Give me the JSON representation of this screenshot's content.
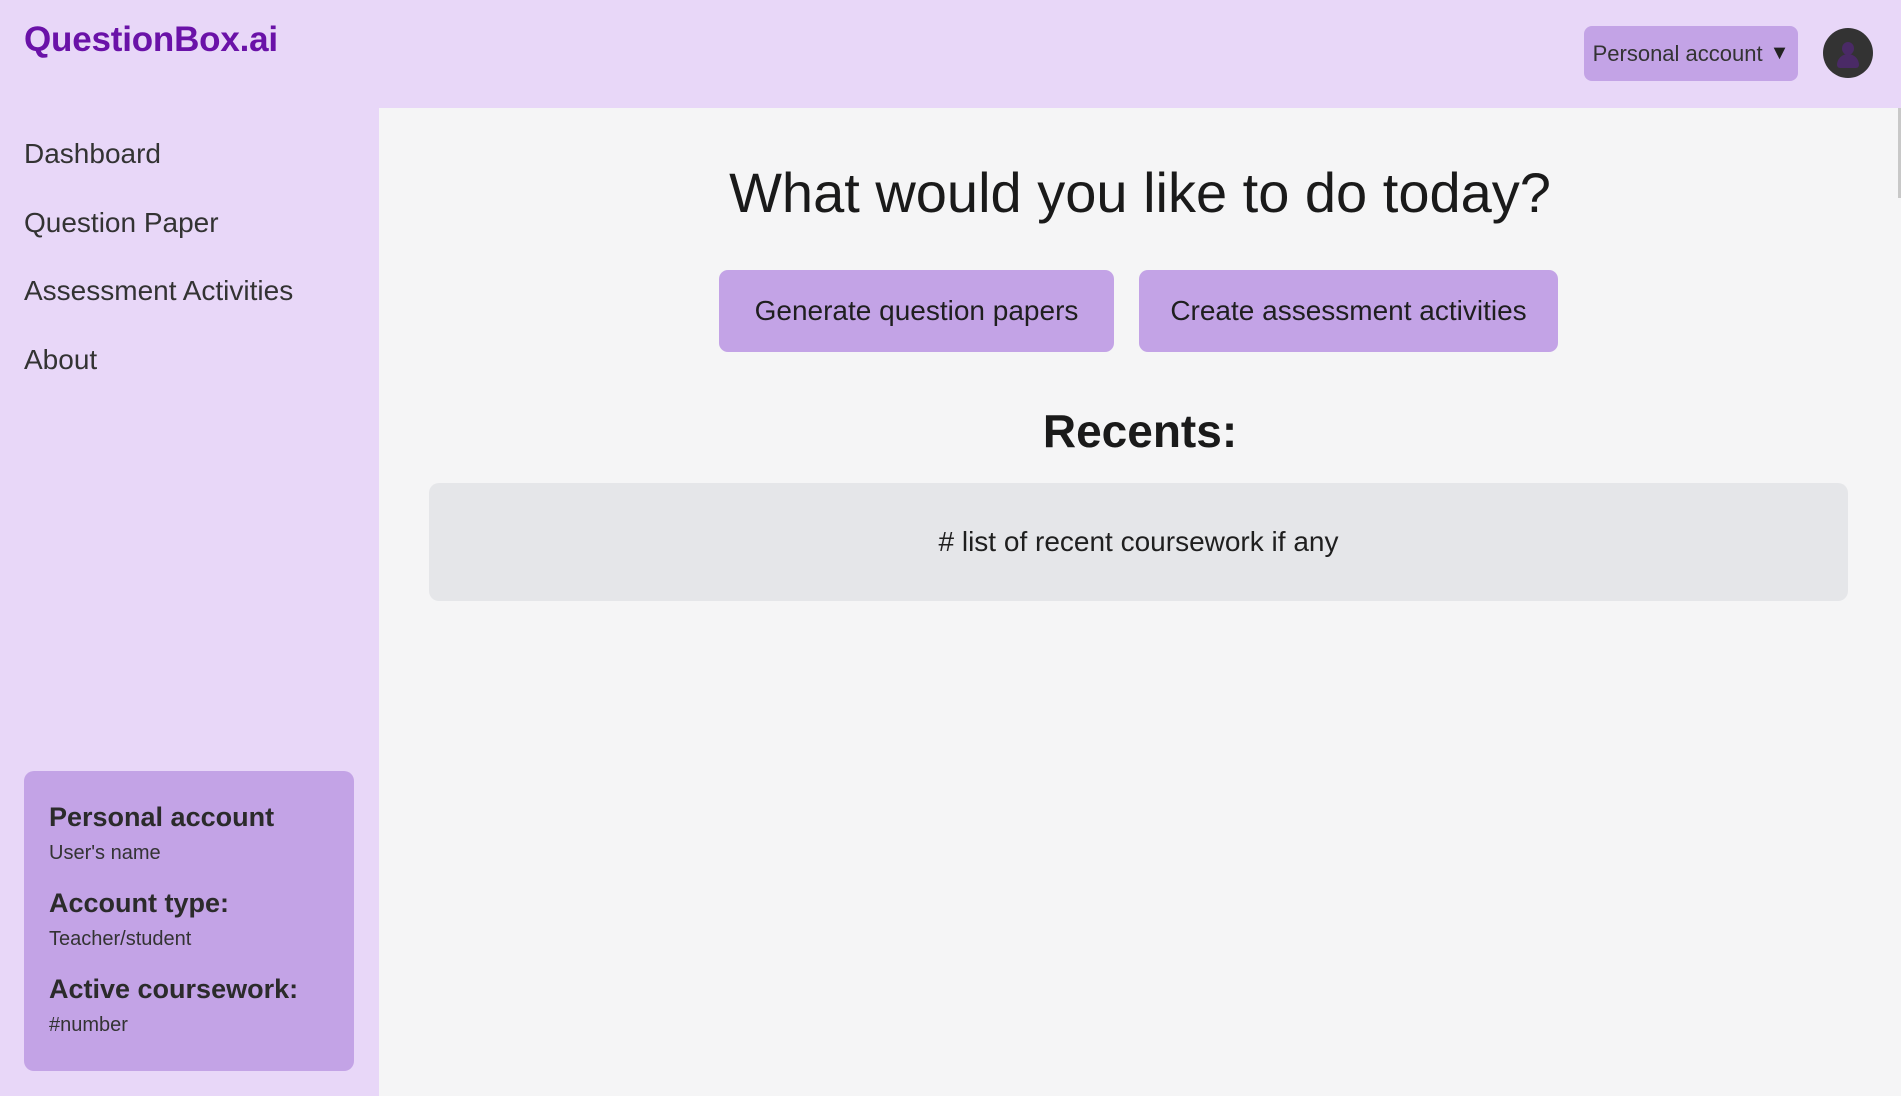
{
  "header": {
    "logo": "QuestionBox.ai",
    "account_dropdown_label": "Personal account",
    "account_dropdown_icon": "caret-down-icon",
    "avatar_icon": "user-avatar-icon"
  },
  "sidebar": {
    "items": [
      {
        "label": "Dashboard"
      },
      {
        "label": "Question Paper"
      },
      {
        "label": "Assessment Activities"
      },
      {
        "label": "About"
      }
    ],
    "account_card": {
      "title": "Personal account",
      "user_name": "User's name",
      "account_type_label": "Account type:",
      "account_type_value": "Teacher/student",
      "active_coursework_label": "Active coursework:",
      "active_coursework_value": "#number"
    }
  },
  "main": {
    "title": "What would you like to do today?",
    "generate_button": "Generate question papers",
    "create_button": "Create assessment activities",
    "recents_title": "Recents:",
    "recents_placeholder": "# list of recent coursework if any"
  },
  "colors": {
    "background": "#e8d7f8",
    "accent": "#c3a3e6",
    "logo": "#6a12a8",
    "main_background": "#f5f5f6",
    "recents_box": "#e5e6e9"
  }
}
